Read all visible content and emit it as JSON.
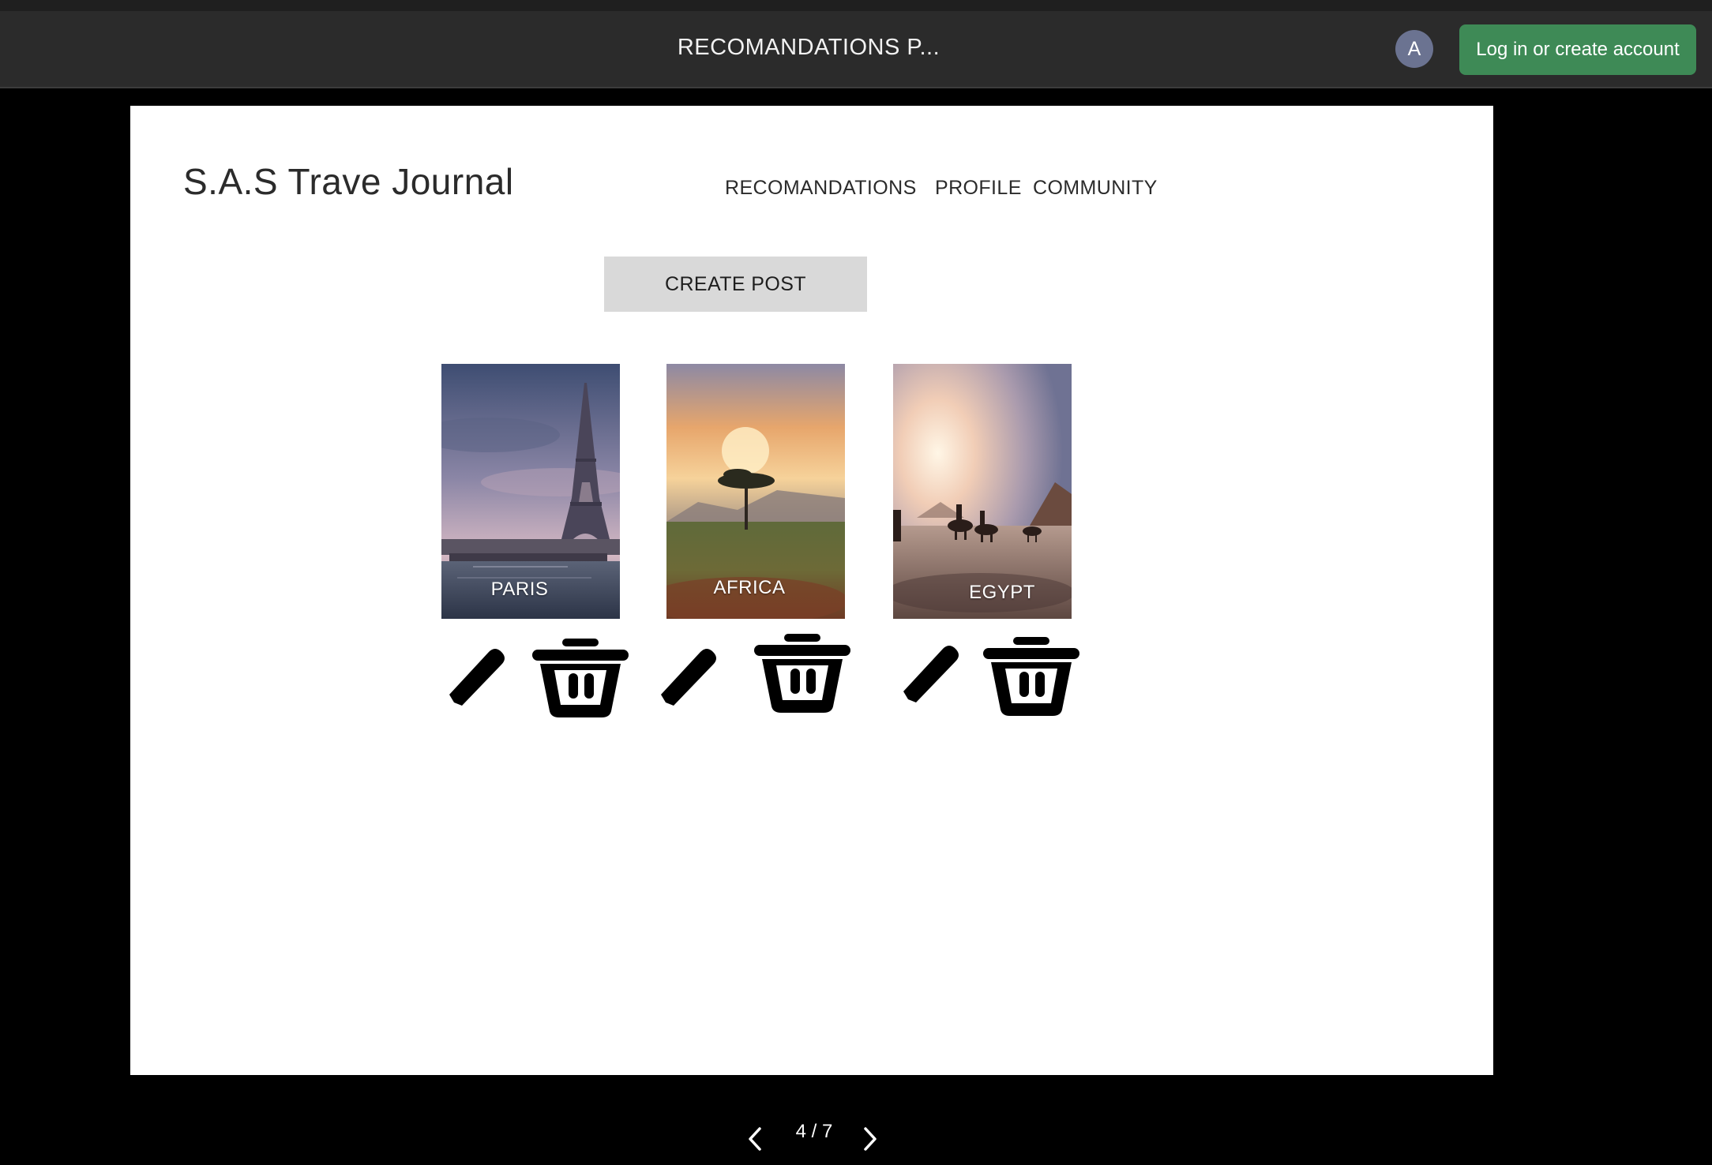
{
  "app_bar": {
    "document_title": "RECOMANDATIONS P...",
    "avatar_initial": "A",
    "login_label": "Log in or create account",
    "login_color": "#3e8a56"
  },
  "slide": {
    "brand": "S.A.S Trave Journal",
    "nav": {
      "recommendations": "RECOMANDATIONS",
      "profile": "PROFILE",
      "community": "COMMUNITY"
    },
    "create_post_label": "CREATE POST",
    "cards": [
      {
        "label": "PARIS",
        "image": "eiffel-tower-photo"
      },
      {
        "label": "AFRICA",
        "image": "savanna-sunset-photo"
      },
      {
        "label": "EGYPT",
        "image": "pyramids-camels-photo"
      }
    ],
    "card_icons": [
      "pencil-icon",
      "trash-icon"
    ]
  },
  "pager": {
    "current": "4 / 7",
    "prev_icon": "chevron-left-icon",
    "next_icon": "chevron-right-icon"
  }
}
